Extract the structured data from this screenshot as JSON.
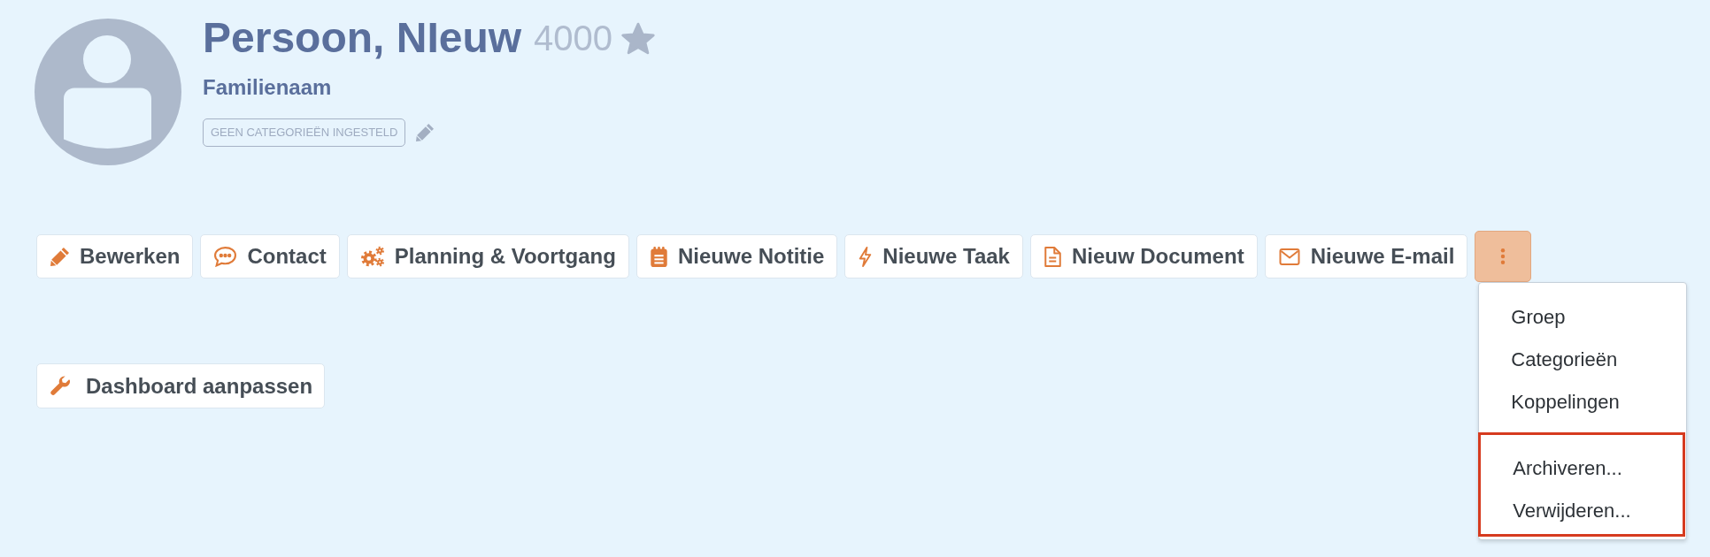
{
  "profile": {
    "name": "Persoon, NIeuw",
    "number": "4000",
    "starred": false,
    "subtitle": "Familienaam",
    "categories_tag": "GEEN CATEGORIEËN INGESTELD"
  },
  "actions": [
    {
      "label": "Bewerken"
    },
    {
      "label": "Contact"
    },
    {
      "label": "Planning & Voortgang"
    },
    {
      "label": "Nieuwe Notitie"
    },
    {
      "label": "Nieuwe Taak"
    },
    {
      "label": "Nieuw Document"
    },
    {
      "label": "Nieuwe E-mail"
    }
  ],
  "more_button": {
    "expanded": true
  },
  "more_menu": {
    "sections": [
      {
        "highlighted": false,
        "items": [
          {
            "label": "Groep"
          },
          {
            "label": "Categorieën"
          },
          {
            "label": "Koppelingen"
          }
        ]
      },
      {
        "highlighted": true,
        "items": [
          {
            "label": "Archiveren..."
          },
          {
            "label": "Verwijderen..."
          }
        ]
      }
    ]
  },
  "dashboard_button": {
    "label": "Dashboard aanpassen"
  }
}
